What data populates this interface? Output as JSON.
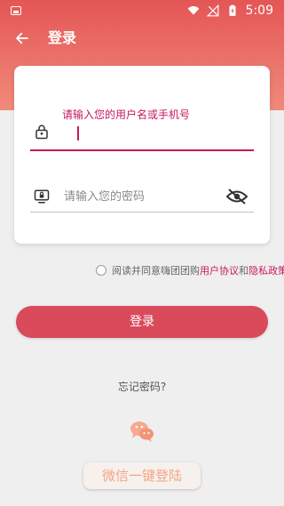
{
  "status_bar": {
    "time": "5:09",
    "icons": [
      "gallery-icon",
      "wifi-icon",
      "signal-icon",
      "battery-charging-icon"
    ]
  },
  "header": {
    "title": "登录",
    "back_icon": "arrow-left-icon",
    "colors": {
      "gradient_top": "#e45656",
      "gradient_bottom": "#f08a7b"
    }
  },
  "form": {
    "username": {
      "label": "请输入您的用户名或手机号",
      "value": ""
    },
    "password": {
      "placeholder": "请输入您的密码",
      "value": ""
    }
  },
  "agreement": {
    "prefix": "阅读并同意嗨团团购",
    "user_agreement": "用户协议",
    "and": "和",
    "privacy_policy": "隐私政策",
    "checked": false
  },
  "login_button": "登录",
  "forgot_password": "忘记密码?",
  "wechat_login": "微信一键登陆",
  "accent_color": "#c8175f",
  "button_color": "#d94a5b"
}
